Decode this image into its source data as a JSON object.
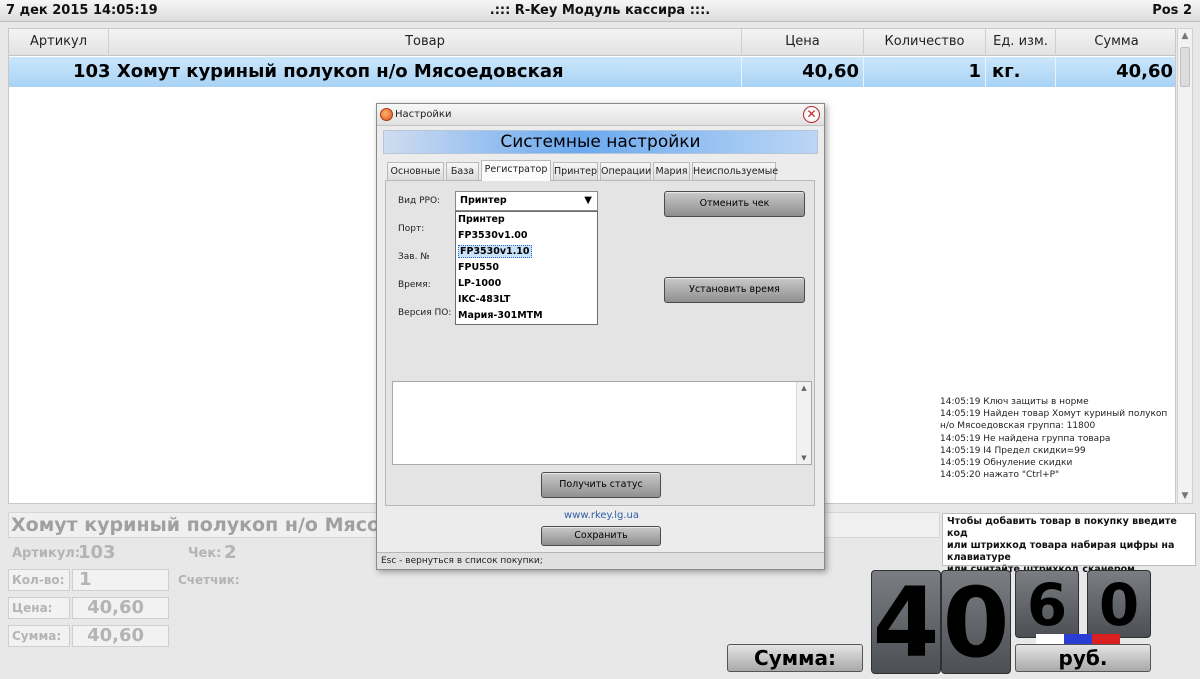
{
  "titlebar": {
    "datetime": "7 дек 2015 14:05:19",
    "title": ".::: R-Key Модуль кассира :::.",
    "pos": "Pos 2"
  },
  "grid": {
    "columns": [
      "Артикул",
      "Товар",
      "Цена",
      "Количество",
      "Ед. изм.",
      "Сумма"
    ],
    "rows": [
      {
        "article": "",
        "product": "103 Хомут куриный полукоп н/о Мясоедовская",
        "price": "40,60",
        "qty": "1",
        "unit": "кг.",
        "sum": "40,60"
      }
    ]
  },
  "log": [
    "14:05:19 Ключ защиты в норме",
    "14:05:19 Найден товар Хомут куриный полукоп н/о Мясоедовская группа: 11800",
    "14:05:19 Не найдена группа товара",
    "14:05:19 I4 Предел скидки=99",
    "14:05:19 Обнуление скидки",
    "14:05:20 нажато \"Ctrl+P\""
  ],
  "bottom": {
    "product_name": "Хомут куриный полукоп н/о Мясоедовская",
    "article_label": "Артикул:",
    "article_value": "103",
    "check_label": "Чек:",
    "check_value": "2",
    "qty_label": "Кол-во:",
    "qty_value": "1",
    "counter_label": "Счетчик:",
    "price_label": "Цена:",
    "price_value": "40,60",
    "sum_label": "Сумма:",
    "sum_value": "40,60"
  },
  "hint": {
    "line1": "Чтобы добавить товар в покупку введите код",
    "line2": "или штрихкод товара набирая цифры на",
    "line3": "клавиатуре",
    "line4": "или считайте штрихкод сканером"
  },
  "display": {
    "sum_button": "Сумма:",
    "digit1": "4",
    "digit2": "0",
    "digit3": "6",
    "digit4": "0",
    "currency": "руб."
  },
  "dialog": {
    "window_title": "Настройки",
    "banner": "Системные настройки",
    "tabs": [
      "Основные",
      "База",
      "Регистратор",
      "Принтер",
      "Операции",
      "Мария",
      "Неиспользуемые"
    ],
    "active_tab": "Регистратор",
    "labels": {
      "rro_type": "Вид РРО:",
      "port": "Порт:",
      "serial": "Зав. №",
      "time": "Время:",
      "fw_version": "Версия ПО:"
    },
    "select_value": "Принтер",
    "options": [
      "Принтер",
      "FP3530v1.00",
      "FP3530v1.10",
      "FPU550",
      "LP-1000",
      "IKC-483LT",
      "Мария-301МТМ"
    ],
    "highlighted_option": "FP3530v1.10",
    "buttons": {
      "cancel_check": "Отменить чек",
      "set_time": "Установить время",
      "get_status": "Получить статус",
      "save": "Сохранить"
    },
    "link": "www.rkey.lg.ua",
    "status": "Esc - вернуться в список покупки;"
  },
  "colors": {
    "selected_row": "#a8d3f5",
    "banner_blue": "#6aa9ef",
    "link": "#2e5ea8",
    "flag_blue": "#2a3ed6",
    "flag_red": "#d91f1f"
  }
}
